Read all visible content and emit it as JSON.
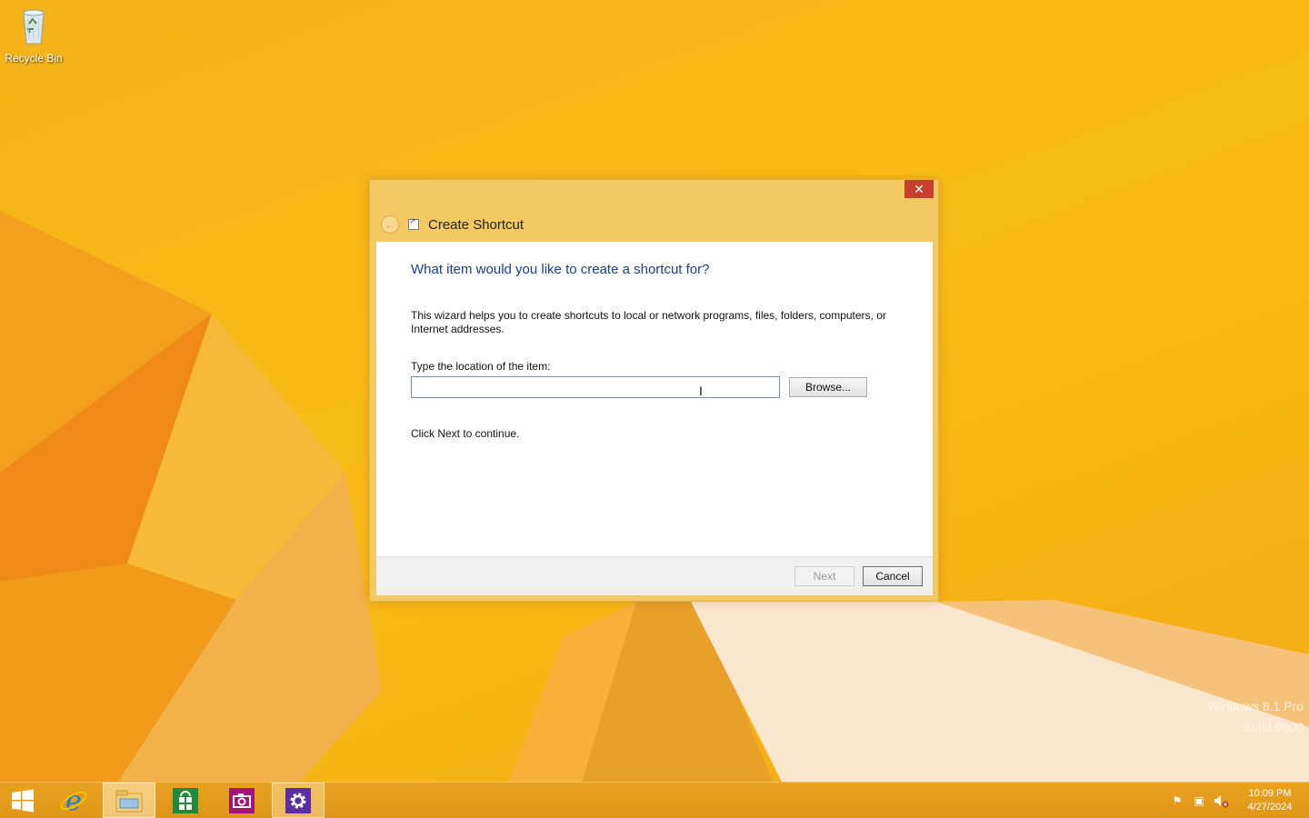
{
  "desktop": {
    "icons": [
      {
        "label": "Recycle Bin",
        "icon": "recycle-bin-icon"
      }
    ],
    "watermark": {
      "line1": "Windows 8.1 Pro",
      "line2": "Build 9600"
    }
  },
  "dialog": {
    "title": "Create Shortcut",
    "close_glyph": "✕",
    "back_glyph": "←",
    "heading": "What item would you like to create a shortcut for?",
    "description": "This wizard helps you to create shortcuts to local or network programs, files, folders, computers, or Internet addresses.",
    "location_label": "Type the location of the item:",
    "location_value": "",
    "browse_label": "Browse...",
    "continue_text": "Click Next to continue.",
    "next_label": "Next",
    "cancel_label": "Cancel"
  },
  "taskbar": {
    "buttons": [
      {
        "name": "start",
        "icon": "windows-logo-icon"
      },
      {
        "name": "internet-explorer",
        "icon": "ie-icon"
      },
      {
        "name": "file-explorer",
        "icon": "folder-icon"
      },
      {
        "name": "store",
        "icon": "store-icon"
      },
      {
        "name": "camera",
        "icon": "camera-icon"
      },
      {
        "name": "settings",
        "icon": "gear-icon"
      }
    ],
    "tray": {
      "icons": [
        "flag-icon",
        "network-icon",
        "volume-muted-icon"
      ],
      "time": "10:09 PM",
      "date": "4/27/2024"
    }
  },
  "colors": {
    "accent": "#f3c963",
    "heading": "#1b3f8b",
    "close": "#c7402e",
    "taskbar": "#e39c1b"
  }
}
